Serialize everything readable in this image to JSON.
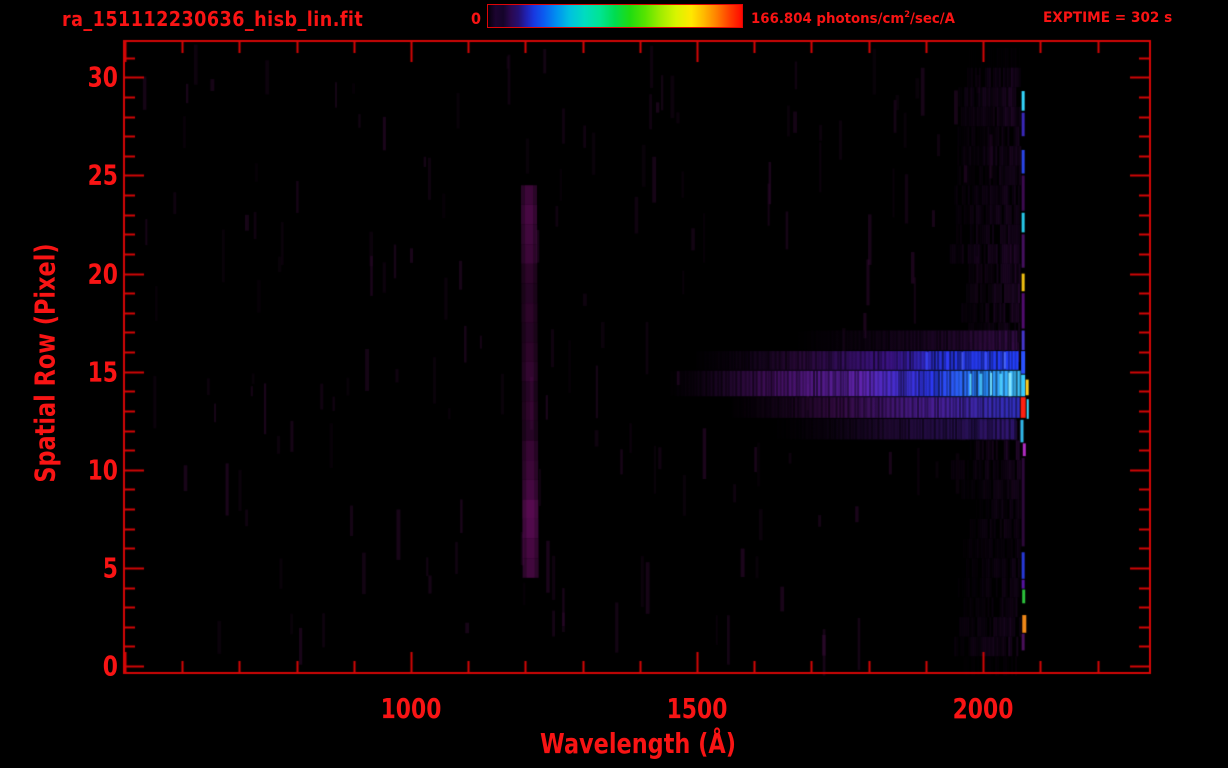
{
  "header": {
    "title": "ra_151112230636_hisb_lin.fit",
    "exptime_label": "EXPTIME = 302 s"
  },
  "colorbar": {
    "min_label": "0",
    "max_label_prefix": "166.804 photons/cm",
    "max_label_sup": "2",
    "max_label_suffix": "/sec/A",
    "gradient_stops": [
      [
        0,
        "#05000a"
      ],
      [
        0.03,
        "#1c0430"
      ],
      [
        0.06,
        "#14042a"
      ],
      [
        0.09,
        "#2a0850"
      ],
      [
        0.12,
        "#241070"
      ],
      [
        0.15,
        "#2020b0"
      ],
      [
        0.18,
        "#1838e0"
      ],
      [
        0.22,
        "#0b5cf0"
      ],
      [
        0.27,
        "#0090f0"
      ],
      [
        0.32,
        "#00c0e0"
      ],
      [
        0.38,
        "#00dcc0"
      ],
      [
        0.44,
        "#00e494"
      ],
      [
        0.5,
        "#00dc50"
      ],
      [
        0.56,
        "#20dc10"
      ],
      [
        0.62,
        "#58e400"
      ],
      [
        0.68,
        "#a0ec00"
      ],
      [
        0.74,
        "#d8f400"
      ],
      [
        0.8,
        "#ffe800"
      ],
      [
        0.85,
        "#ffb800"
      ],
      [
        0.9,
        "#ff8000"
      ],
      [
        0.95,
        "#ff4000"
      ],
      [
        1,
        "#ff0800"
      ]
    ]
  },
  "colors": {
    "background": "#000000",
    "text": "#f81414",
    "axis": "#d40606"
  },
  "chart_data": {
    "type": "heatmap",
    "title": "ra_151112230636_hisb_lin.fit",
    "xlabel": "Wavelength (Å)",
    "ylabel": "Spatial Row (Pixel)",
    "xlim": [
      500,
      2290
    ],
    "ylim": [
      -0.3,
      31.8
    ],
    "x_axis": {
      "ticks": [
        {
          "value": 1000,
          "label": "1000"
        },
        {
          "value": 1500,
          "label": "1500"
        },
        {
          "value": 2000,
          "label": "2000"
        }
      ],
      "minor_step": 100
    },
    "y_axis": {
      "ticks": [
        {
          "value": 0,
          "label": "0"
        },
        {
          "value": 5,
          "label": "5"
        },
        {
          "value": 10,
          "label": "10"
        },
        {
          "value": 15,
          "label": "15"
        },
        {
          "value": 20,
          "label": "20"
        },
        {
          "value": 25,
          "label": "25"
        },
        {
          "value": 30,
          "label": "30"
        }
      ],
      "minor_step": 1
    },
    "colorbar_range": {
      "min": 0,
      "max": 166.804,
      "units": "photons/cm^2/sec/A"
    },
    "exposure_time_s": 302,
    "features": {
      "noise_streaks": {
        "seed": 911,
        "count": 170,
        "wl_range": [
          515,
          2045
        ],
        "row_range": [
          0.5,
          31
        ],
        "color": [
          70,
          14,
          70
        ]
      },
      "lyman_band": {
        "wl_center": 1209,
        "wl_half_width": 14,
        "tilt_A_per_row": -0.15,
        "row_start": 5,
        "row_end": 24,
        "color": [
          82,
          12,
          78
        ],
        "row_intensity": [
          0.55,
          0.62,
          0.75,
          0.8,
          0.6,
          0.5,
          0.45,
          0.3,
          0.35,
          0.3,
          0.4,
          0.35,
          0.3,
          0.35,
          0.3,
          0.35,
          0.5,
          0.55,
          0.62,
          0.5
        ]
      },
      "noise_column": {
        "wl": [
          1938,
          2064
        ],
        "seed": 417,
        "color": [
          64,
          14,
          80
        ],
        "row_intensity": [
          0.12,
          0.5,
          0.45,
          0.3,
          0.3,
          0.35,
          0.3,
          0.35,
          0.4,
          0.35,
          0.4,
          0.6,
          0.55,
          0,
          0,
          0,
          0.5,
          0.45,
          0.5,
          0.55,
          0.5,
          0.55,
          0.5,
          0.45,
          0.4,
          0.35,
          0.4,
          0.35,
          0.5,
          0.55,
          0.45,
          0.1
        ]
      },
      "h_bands": [
        {
          "rows": [
            16.1,
            17.1
          ],
          "wl": [
            1650,
            2060
          ],
          "stops": [
            [
              0,
              "rgba(26,5,32,0)"
            ],
            [
              0.5,
              "rgba(40,8,52,0.5)"
            ],
            [
              1,
              "rgba(58,14,80,0.8)"
            ]
          ]
        },
        {
          "rows": [
            15.1,
            16.05
          ],
          "wl": [
            1480,
            2062
          ],
          "stops": [
            [
              0,
              "rgba(30,6,40,0)"
            ],
            [
              0.35,
              "rgba(58,13,80,0.7)"
            ],
            [
              0.62,
              "rgba(70,23,160,0.85)"
            ],
            [
              0.78,
              "rgba(40,55,238,0.95)"
            ],
            [
              1,
              "rgba(35,64,255,1)"
            ]
          ]
        },
        {
          "rows": [
            13.75,
            15.05
          ],
          "wl": [
            1440,
            2066
          ],
          "stops": [
            [
              0,
              "rgba(42,8,48,0)"
            ],
            [
              0.3,
              "rgba(85,19,120,0.75)"
            ],
            [
              0.55,
              "rgba(106,40,192,0.9)"
            ],
            [
              0.75,
              "rgba(47,59,255,0.95)"
            ],
            [
              0.9,
              "rgba(40,140,255,1)"
            ],
            [
              1,
              "rgba(64,200,255,1)"
            ]
          ]
        },
        {
          "rows": [
            12.65,
            13.7
          ],
          "wl": [
            1540,
            2064
          ],
          "stops": [
            [
              0,
              "rgba(37,6,40,0)"
            ],
            [
              0.4,
              "rgba(74,16,96,0.7)"
            ],
            [
              0.7,
              "rgba(85,34,170,0.85)"
            ],
            [
              1,
              "rgba(51,51,204,0.95)"
            ]
          ]
        },
        {
          "rows": [
            11.55,
            12.6
          ],
          "wl": [
            1620,
            2058
          ],
          "stops": [
            [
              0,
              "rgba(28,5,32,0)"
            ],
            [
              0.5,
              "rgba(56,16,90,0.55)"
            ],
            [
              1,
              "rgba(64,32,160,0.7)"
            ]
          ]
        }
      ],
      "bright_streaks": [
        {
          "wl": 1978,
          "rows": [
            13.8,
            14.9
          ],
          "color": "rgba(90,220,255,0.9)",
          "w": 2
        },
        {
          "wl": 1996,
          "rows": [
            13.8,
            14.9
          ],
          "color": "rgba(70,200,255,0.85)",
          "w": 3
        },
        {
          "wl": 2014,
          "rows": [
            13.8,
            14.95
          ],
          "color": "rgba(120,230,255,0.9)",
          "w": 2
        },
        {
          "wl": 2031,
          "rows": [
            13.8,
            14.9
          ],
          "color": "rgba(80,210,255,0.9)",
          "w": 3
        },
        {
          "wl": 2047,
          "rows": [
            13.75,
            14.95
          ],
          "color": "rgba(140,235,255,0.95)",
          "w": 3
        },
        {
          "wl": 1902,
          "rows": [
            15.1,
            16.0
          ],
          "color": "rgba(60,70,255,0.8)",
          "w": 3
        },
        {
          "wl": 1938,
          "rows": [
            15.1,
            16.0
          ],
          "color": "rgba(50,60,250,0.8)",
          "w": 3
        },
        {
          "wl": 1964,
          "rows": [
            15.1,
            16.0
          ],
          "color": "rgba(70,90,255,0.85)",
          "w": 2
        },
        {
          "wl": 2005,
          "rows": [
            15.1,
            16.0
          ],
          "color": "rgba(60,80,255,0.85)",
          "w": 3
        },
        {
          "wl": 2038,
          "rows": [
            15.15,
            16.0
          ],
          "color": "rgba(80,110,255,0.9)",
          "w": 2
        }
      ],
      "emission_line": {
        "wl": 2070,
        "segments": [
          {
            "rows": [
              28.3,
              29.3
            ],
            "color": "#35d8ff",
            "dw": 0,
            "w": 3
          },
          {
            "rows": [
              27.0,
              28.2
            ],
            "color": "#3a28b8",
            "dw": 0,
            "w": 3
          },
          {
            "rows": [
              25.1,
              26.3
            ],
            "color": "#2a46e8",
            "dw": 0,
            "w": 3
          },
          {
            "rows": [
              23.2,
              25.0
            ],
            "color": "#3c0a50",
            "dw": 0,
            "w": 3
          },
          {
            "rows": [
              22.1,
              23.1
            ],
            "color": "#28c8e8",
            "dw": 0,
            "w": 3
          },
          {
            "rows": [
              20.3,
              22.0
            ],
            "color": "#44105e",
            "dw": 0,
            "w": 3
          },
          {
            "rows": [
              19.1,
              20.0
            ],
            "color": "#f0c012",
            "dw": 0,
            "w": 3
          },
          {
            "rows": [
              17.2,
              19.0
            ],
            "color": "#500c6e",
            "dw": 0,
            "w": 3
          },
          {
            "rows": [
              16.1,
              17.1
            ],
            "color": "#4636cc",
            "dw": 0,
            "w": 3
          },
          {
            "rows": [
              14.9,
              16.05
            ],
            "color": "#2a52ff",
            "dw": 0,
            "w": 4
          },
          {
            "rows": [
              13.75,
              14.85
            ],
            "color": "#38ccff",
            "dw": 0,
            "w": 4
          },
          {
            "rows": [
              13.8,
              14.6
            ],
            "color": "#ffd020",
            "dw": 7,
            "w": 3
          },
          {
            "rows": [
              12.65,
              13.7
            ],
            "color": "#ff2010",
            "dw": 0,
            "w": 5
          },
          {
            "rows": [
              12.6,
              13.6
            ],
            "color": "#40d8ff",
            "dw": 8,
            "w": 2
          },
          {
            "rows": [
              11.4,
              12.55
            ],
            "color": "#30b8e8",
            "dw": -2,
            "w": 3
          },
          {
            "rows": [
              10.7,
              11.35
            ],
            "color": "#b02cc0",
            "dw": 2,
            "w": 3
          },
          {
            "rows": [
              6.1,
              10.6
            ],
            "color": "#2c0838",
            "dw": 0,
            "w": 3
          },
          {
            "rows": [
              4.45,
              5.8
            ],
            "color": "#2838d8",
            "dw": 0,
            "w": 3
          },
          {
            "rows": [
              3.95,
              4.4
            ],
            "color": "#5514a0",
            "dw": 0,
            "w": 3
          },
          {
            "rows": [
              3.2,
              3.9
            ],
            "color": "#2cc23c",
            "dw": 1,
            "w": 3
          },
          {
            "rows": [
              1.7,
              2.6
            ],
            "color": "#f08818",
            "dw": 2,
            "w": 4
          },
          {
            "rows": [
              0.8,
              1.65
            ],
            "color": "#49105a",
            "dw": 0,
            "w": 3
          }
        ]
      }
    }
  }
}
